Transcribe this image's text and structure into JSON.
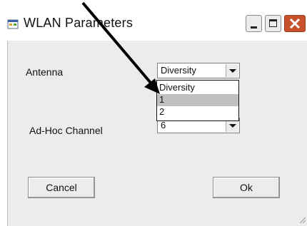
{
  "window": {
    "title": "WLAN Parameters",
    "icons": {
      "app": "window-app-icon",
      "minimize": "minimize-icon",
      "maximize": "maximize-icon",
      "close": "close-icon"
    }
  },
  "form": {
    "antenna_label": "Antenna",
    "antenna_value": "Diversity",
    "antenna_options": [
      "Diversity",
      "1",
      "2"
    ],
    "antenna_highlighted_option": "1",
    "channel_label": "Ad-Hoc Channel",
    "channel_value": "6"
  },
  "buttons": {
    "cancel": "Cancel",
    "ok": "Ok"
  },
  "colors": {
    "close_button": "#c8502c",
    "dialog_background": "#ececec",
    "highlight": "#c0c0c0",
    "annotation_arrow": "#000000"
  }
}
